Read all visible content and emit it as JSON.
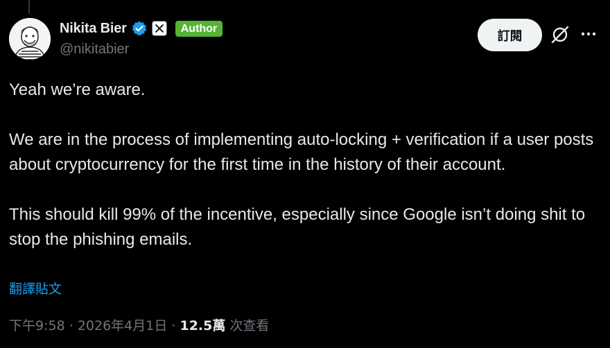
{
  "author": {
    "display_name": "Nikita Bier",
    "handle": "@nikitabier",
    "badge": "Author",
    "verified_color": "#1d9bf0",
    "author_badge_color": "#54b435"
  },
  "actions": {
    "subscribe_label": "訂閱"
  },
  "tweet": {
    "paragraphs": [
      "Yeah we’re aware.",
      "We are in the process of implementing auto-locking + verification if a user posts about cryptocurrency for the first time in the history of their account.",
      "This should kill 99% of the incentive, especially since Google isn’t doing shit to stop the phishing emails."
    ],
    "translate_label": "翻譯貼文"
  },
  "meta": {
    "time": "下午9:58",
    "separator": "·",
    "date": "2026年4月1日",
    "views_count": "12.5萬",
    "views_label": "次查看"
  },
  "icons": [
    "avatar",
    "verified-badge-icon",
    "x-affiliate-icon",
    "grok-icon",
    "more-icon"
  ]
}
